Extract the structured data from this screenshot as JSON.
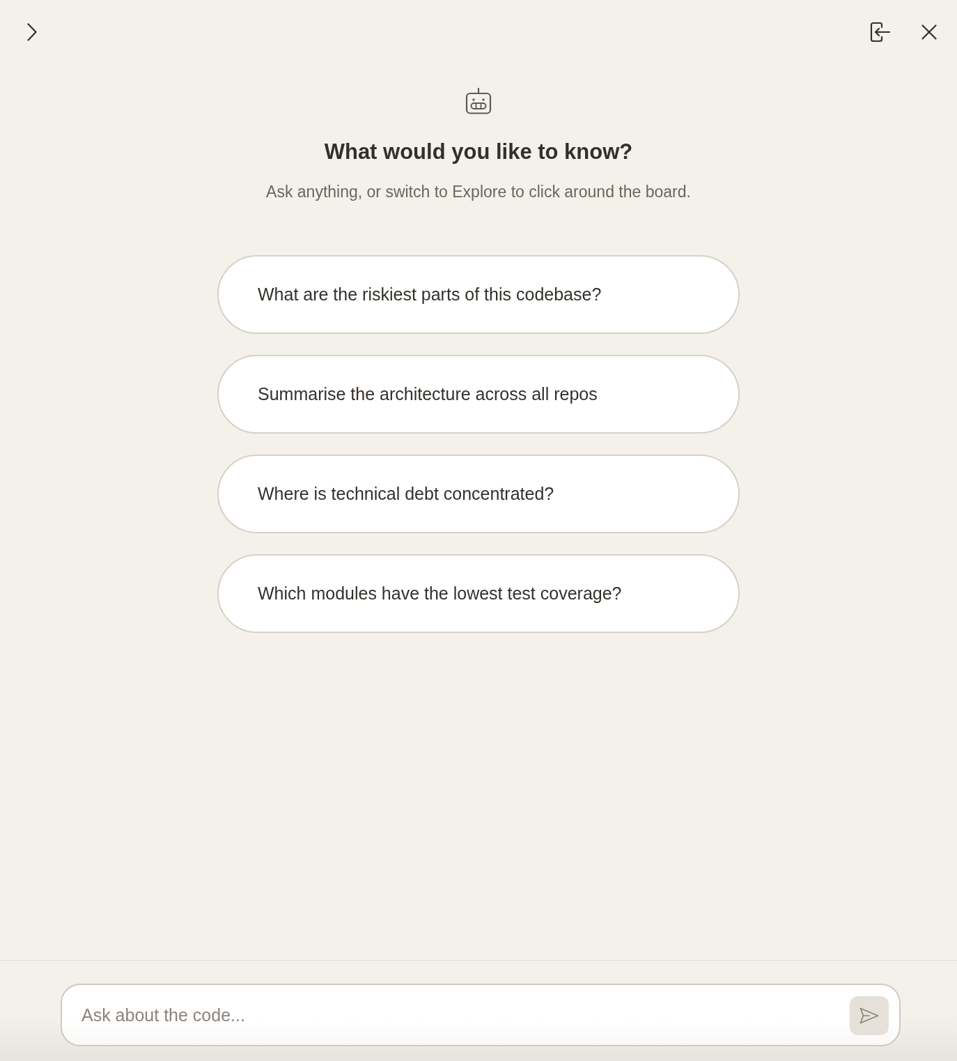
{
  "empty_state": {
    "title": "What would you like to know?",
    "subtitle": "Ask anything, or switch to Explore to click around the board."
  },
  "suggestions": [
    "What are the riskiest parts of this codebase?",
    "Summarise the architecture across all repos",
    "Where is technical debt concentrated?",
    "Which modules have the lowest test coverage?"
  ],
  "composer": {
    "placeholder": "Ask about the code..."
  }
}
